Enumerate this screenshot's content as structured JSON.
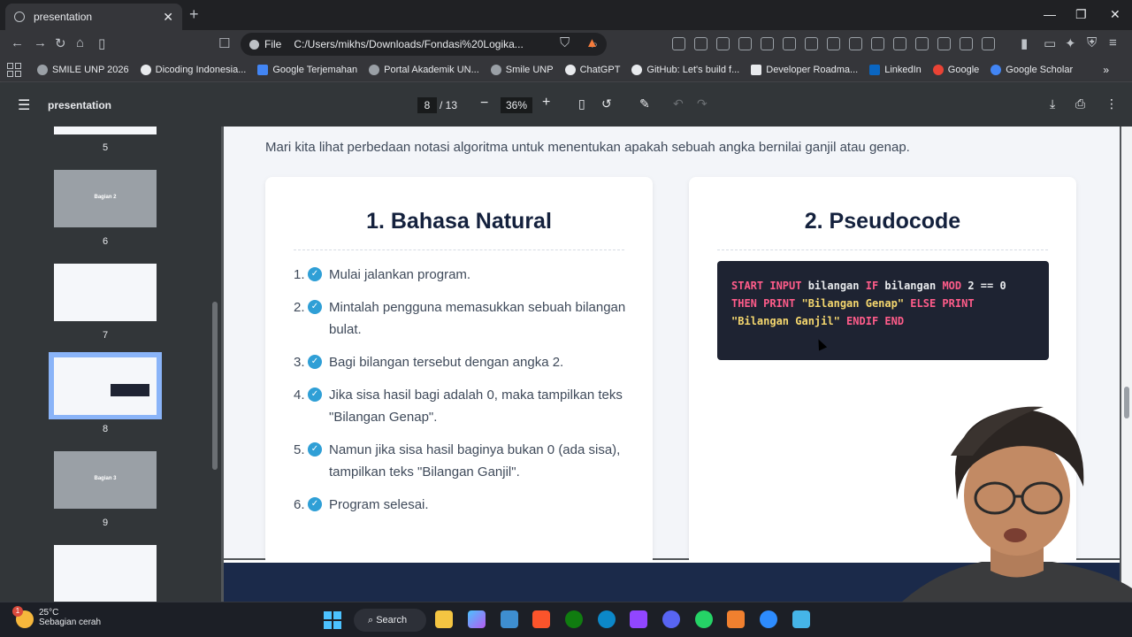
{
  "browser": {
    "tab_title": "presentation",
    "omnibox": {
      "scheme_label": "File",
      "url": "C:/Users/mikhs/Downloads/Fondasi%20Logika..."
    },
    "bookmarks": [
      {
        "label": "SMILE UNP 2026",
        "color": "#9aa0a6"
      },
      {
        "label": "Dicoding Indonesia...",
        "color": "#e8eaed"
      },
      {
        "label": "Google Terjemahan",
        "color": "#4285f4"
      },
      {
        "label": "Portal Akademik UN...",
        "color": "#9aa0a6"
      },
      {
        "label": "Smile UNP",
        "color": "#9aa0a6"
      },
      {
        "label": "ChatGPT",
        "color": "#e8eaed"
      },
      {
        "label": "GitHub: Let's build f...",
        "color": "#e8eaed"
      },
      {
        "label": "Developer Roadma...",
        "color": "#e8eaed"
      },
      {
        "label": "LinkedIn",
        "color": "#0a66c2"
      },
      {
        "label": "Google",
        "color": "#ea4335"
      },
      {
        "label": "Google Scholar",
        "color": "#4285f4"
      }
    ]
  },
  "pdf_toolbar": {
    "title": "presentation",
    "current_page": "8",
    "total_pages": "/ 13",
    "zoom": "36%"
  },
  "sidebar": {
    "thumbnails": [
      {
        "num": "5",
        "title": ""
      },
      {
        "num": "6",
        "title": "Bagian 2"
      },
      {
        "num": "7",
        "title": ""
      },
      {
        "num": "8",
        "title": ""
      },
      {
        "num": "9",
        "title": "Bagian 3"
      }
    ]
  },
  "slide": {
    "intro": "Mari kita lihat perbedaan notasi algoritma untuk menentukan apakah sebuah angka bernilai ganjil atau genap.",
    "natural": {
      "heading": "1. Bahasa Natural",
      "steps": [
        {
          "num": "1.",
          "text": "Mulai jalankan program."
        },
        {
          "num": "2.",
          "text": "Mintalah pengguna memasukkan sebuah bilangan bulat."
        },
        {
          "num": "3.",
          "text": "Bagi bilangan tersebut dengan angka 2."
        },
        {
          "num": "4.",
          "text": "Jika sisa hasil bagi adalah 0, maka tampilkan teks \"Bilangan Genap\"."
        },
        {
          "num": "5.",
          "text": "Namun jika sisa hasil baginya bukan 0 (ada sisa), tampilkan teks \"Bilangan Ganjil\"."
        },
        {
          "num": "6.",
          "text": "Program selesai."
        }
      ]
    },
    "pseudocode": {
      "heading": "2. Pseudocode",
      "tokens": {
        "t1": "START INPUT",
        "t2": " bilangan ",
        "t3": "IF",
        "t4": " bilangan ",
        "t5": "MOD",
        "t6": " 2 == 0",
        "t7": "THEN PRINT",
        "t8": " \"Bilangan Genap\" ",
        "t9": "ELSE PRINT",
        "t10": "\"Bilangan Ganjil\"",
        "t11": " ENDIF END"
      }
    }
  },
  "taskbar": {
    "temperature": "25°C",
    "condition": "Sebagian cerah",
    "weather_badge": "1",
    "search_label": "Search"
  }
}
